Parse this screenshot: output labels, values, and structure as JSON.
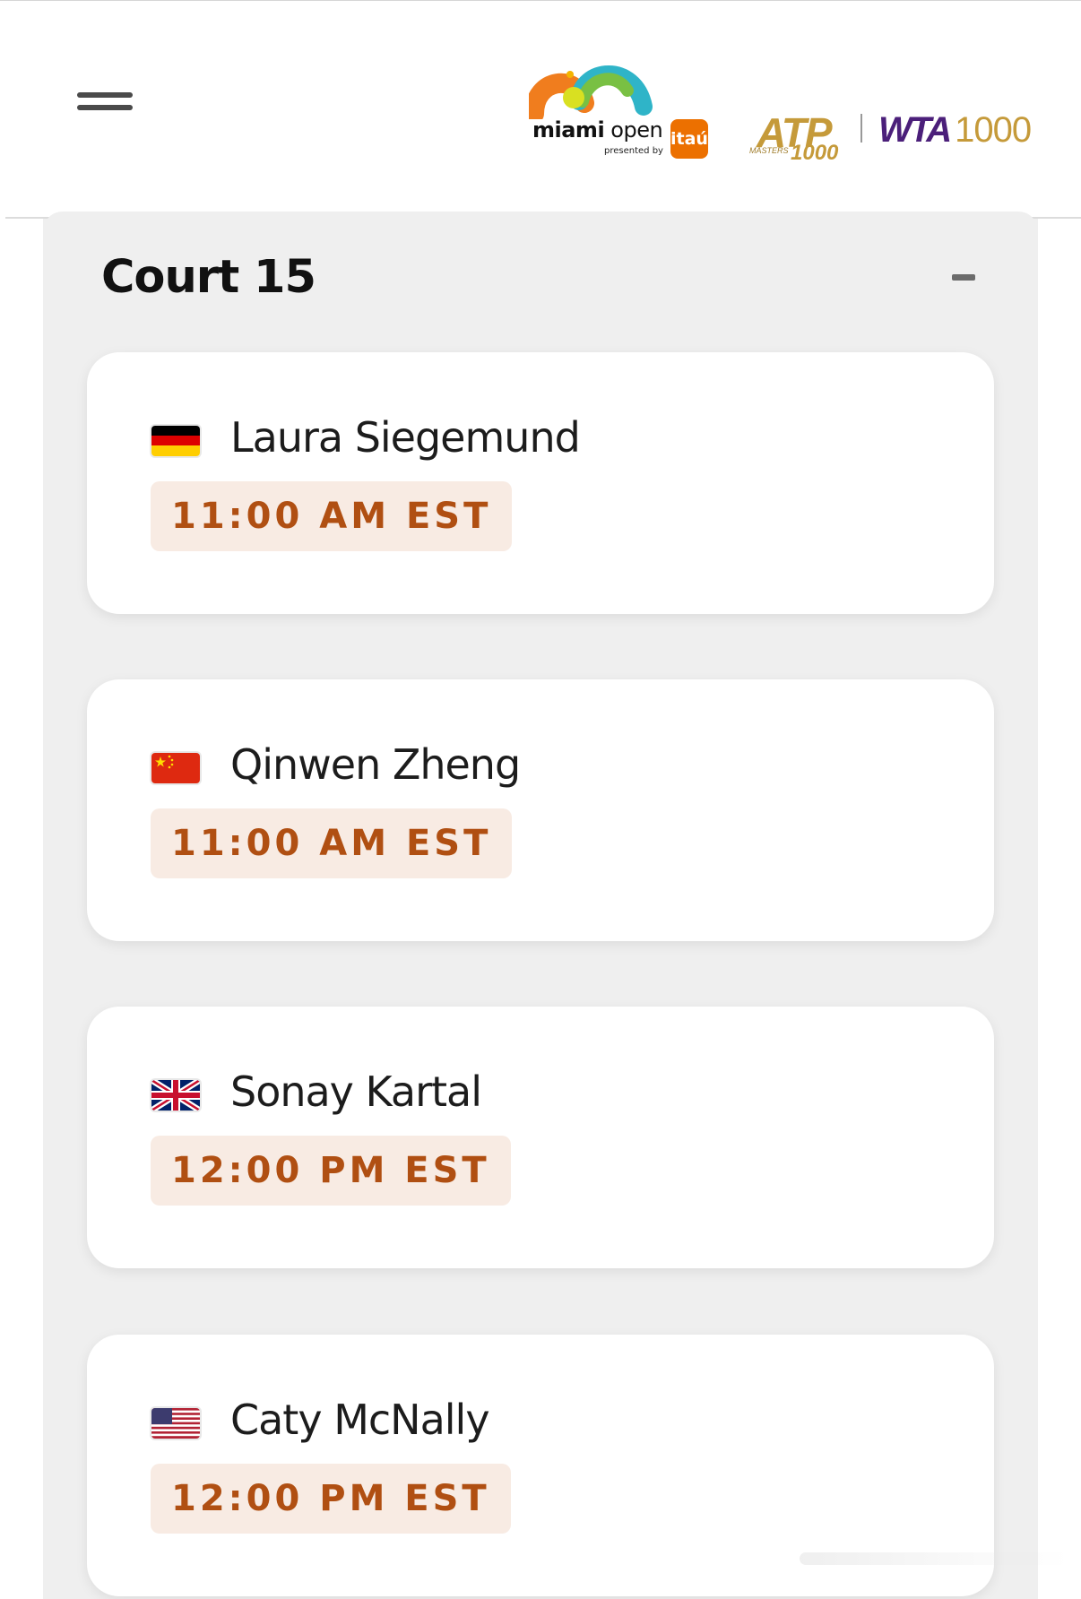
{
  "header": {
    "menu_label": "Menu",
    "miami_bold": "miami",
    "miami_light": " open",
    "presented_by": "presented by",
    "sponsor": "itaú",
    "atp": "ATP",
    "atp_masters": "MASTERS",
    "atp_1000": "1000",
    "wta": "WTA",
    "wta_1000": "1000"
  },
  "court": {
    "title": "Court 15",
    "collapse_icon": "minus-icon"
  },
  "matches": [
    {
      "player": "Laura Siegemund",
      "country": "Germany",
      "flag_icon": "germany-flag-icon",
      "time": "11:00 AM EST"
    },
    {
      "player": "Qinwen Zheng",
      "country": "China",
      "flag_icon": "china-flag-icon",
      "time": "11:00 AM EST"
    },
    {
      "player": "Sonay Kartal",
      "country": "Great Britain",
      "flag_icon": "uk-flag-icon",
      "time": "12:00 PM EST"
    },
    {
      "player": "Caty McNally",
      "country": "United States",
      "flag_icon": "usa-flag-icon",
      "time": "12:00 PM EST"
    }
  ],
  "colors": {
    "time_text": "#b04f12",
    "time_bg": "#f8ebe3",
    "panel_bg": "#efefef",
    "wta_purple": "#4b1f7a",
    "gold": "#c59a3a",
    "itau_orange": "#ec7000"
  }
}
